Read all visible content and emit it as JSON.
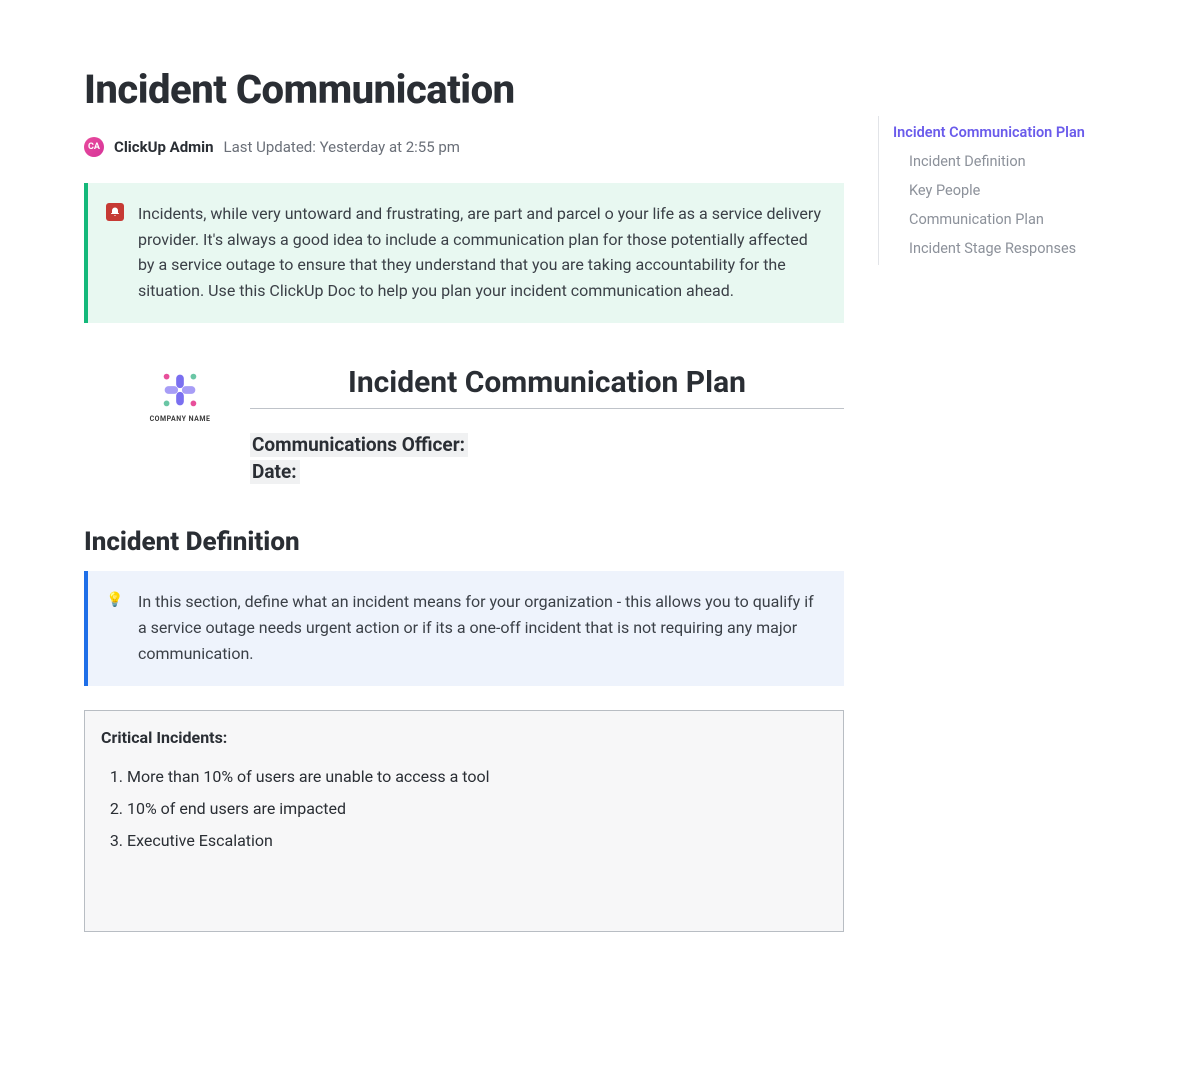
{
  "header": {
    "title": "Incident Communication",
    "avatar_initials": "CA",
    "author": "ClickUp Admin",
    "last_updated_label": "Last Updated: Yesterday at 2:55 pm"
  },
  "intro_callout": {
    "icon_name": "siren-icon",
    "text": "Incidents, while very untoward and frustrating, are part and parcel o your life as a service delivery provider. It's always a good idea to include a communication plan for those potentially affected by a service outage to ensure that they understand that you are taking accountability for the situation. Use this ClickUp Doc to help you plan your incident communication ahead."
  },
  "plan": {
    "logo_caption": "COMPANY NAME",
    "title": "Incident Communication Plan",
    "fields": {
      "comms_officer_label": "Communications Officer:",
      "date_label": "Date:"
    }
  },
  "incident_definition": {
    "heading": "Incident Definition",
    "callout": {
      "icon_name": "bulb-icon",
      "text": "In this section, define what an incident means for your organization - this allows you to qualify if a service outage needs urgent action or if its a one-off incident that is not requiring any major communication."
    },
    "critical": {
      "title": "Critical Incidents:",
      "items": [
        "More than 10% of users are unable to access a tool",
        "10% of end users are impacted",
        "Executive Escalation"
      ]
    }
  },
  "toc": {
    "items": [
      {
        "label": "Incident Communication Plan",
        "active": true,
        "sub": false
      },
      {
        "label": "Incident Definition",
        "active": false,
        "sub": true
      },
      {
        "label": "Key People",
        "active": false,
        "sub": true
      },
      {
        "label": "Communication Plan",
        "active": false,
        "sub": true
      },
      {
        "label": "Incident Stage Responses",
        "active": false,
        "sub": true
      }
    ]
  }
}
